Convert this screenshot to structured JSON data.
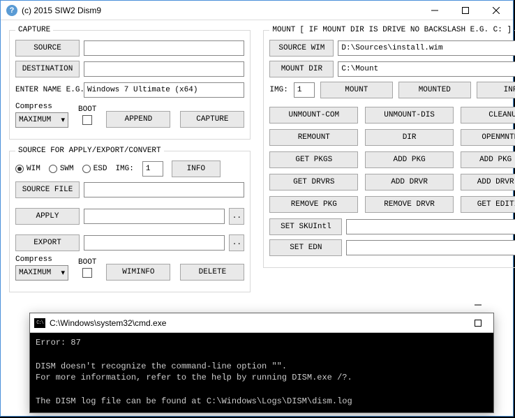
{
  "window": {
    "title": "(c) 2015 SIW2 Dism9"
  },
  "capture": {
    "legend": "CAPTURE",
    "source_btn": "SOURCE",
    "source_val": "",
    "dest_btn": "DESTINATION",
    "dest_val": "",
    "name_label": "ENTER NAME E.G.:",
    "name_val": "Windows 7 Ultimate (x64)",
    "compress_label": "Compress",
    "compress_val": "MAXIMUM",
    "boot_label": "BOOT",
    "append_btn": "APPEND",
    "capture_btn": "CAPTURE"
  },
  "src": {
    "legend": "SOURCE FOR APPLY/EXPORT/CONVERT",
    "wim": "WIM",
    "swm": "SWM",
    "esd": "ESD",
    "img_label": "IMG:",
    "img_val": "1",
    "info_btn": "INFO",
    "srcfile_btn": "SOURCE FILE",
    "srcfile_val": "",
    "apply_btn": "APPLY",
    "apply_val": "",
    "export_btn": "EXPORT",
    "export_val": "",
    "compress_label": "Compress",
    "compress_val": "MAXIMUM",
    "boot_label": "BOOT",
    "wiminfo_btn": "WIMINFO",
    "delete_btn": "DELETE"
  },
  "mount": {
    "legend": "MOUNT",
    "note": "[ IF MOUNT DIR IS DRIVE NO BACKSLASH E.G. C: ]",
    "srcwim_btn": "SOURCE WIM",
    "srcwim_val": "D:\\Sources\\install.wim",
    "mountdir_btn": "MOUNT DIR",
    "mountdir_val": "C:\\Mount",
    "img_label": "IMG:",
    "img_val": "1",
    "mount_btn": "MOUNT",
    "mounted_btn": "MOUNTED",
    "info_btn": "INFO",
    "unmount_com": "UNMOUNT-COM",
    "unmount_dis": "UNMOUNT-DIS",
    "cleanup": "CLEANUP",
    "remount": "REMOUNT",
    "dir": "DIR",
    "openmntdir": "OPENMNTDIR",
    "getpkgs": "GET PKGS",
    "addpkg": "ADD PKG",
    "addpkgfol": "ADD PKG FOL",
    "getdrvrs": "GET DRVRS",
    "adddrvr": "ADD DRVR",
    "adddrvrfol": "ADD DRVR FOL",
    "removepkg": "REMOVE PKG",
    "removedrvr": "REMOVE DRVR",
    "geteditions": "GET EDITIONS",
    "setskuintl": "SET SKUIntl",
    "setskuintl_val": "",
    "setedn": "SET EDN",
    "setedn_val": ""
  },
  "cmd": {
    "title": "C:\\Windows\\system32\\cmd.exe",
    "line1": "Error: 87",
    "line2": "DISM doesn't recognize the command-line option \"\".",
    "line3": "For more information, refer to the help by running DISM.exe /?.",
    "line4": "The DISM log file can be found at C:\\Windows\\Logs\\DISM\\dism.log"
  }
}
